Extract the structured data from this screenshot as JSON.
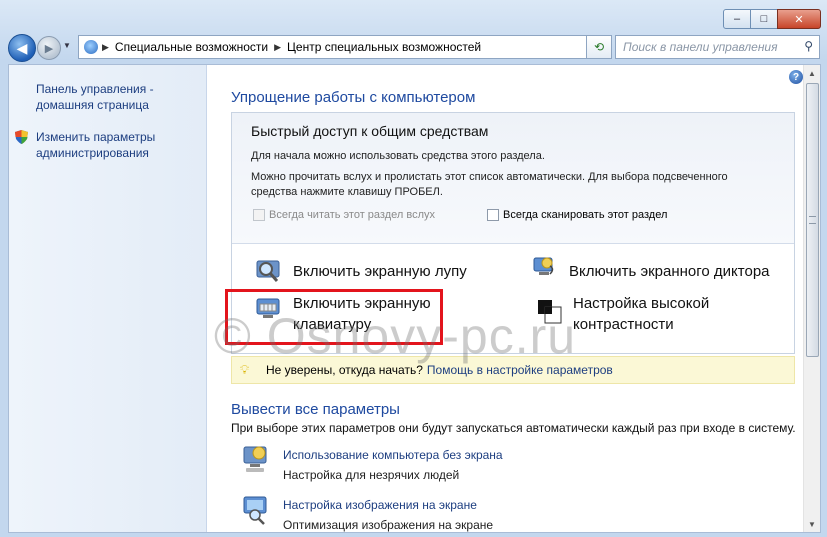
{
  "window": {
    "min_label": "–",
    "max_label": "□",
    "close_label": "✕"
  },
  "nav": {
    "back_glyph": "◀",
    "forward_glyph": "▶",
    "breadcrumb": [
      "Специальные возможности",
      "Центр специальных возможностей"
    ],
    "search_placeholder": "Поиск в панели управления"
  },
  "sidebar": {
    "items": [
      {
        "label": "Панель управления - домашняя страница"
      },
      {
        "label": "Изменить параметры администрирования",
        "icon": "shield-icon"
      }
    ]
  },
  "main": {
    "heading": "Упрощение работы с компьютером",
    "quick": {
      "title": "Быстрый доступ к общим средствам",
      "line1": "Для начала можно использовать средства этого раздела.",
      "line2": "Можно прочитать вслух и пролистать этот список автоматически. Для выбора подсвеченного средства нажмите клавишу ПРОБЕЛ.",
      "chk_read": "Всегда читать этот раздел вслух",
      "chk_scan": "Всегда сканировать этот раздел"
    },
    "tools": {
      "magnifier": "Включить экранную лупу",
      "narrator": "Включить экранного диктора",
      "keyboard_line1": "Включить экранную",
      "keyboard_line2": "клавиатуру",
      "contrast_line1": "Настройка высокой",
      "contrast_line2": "контрастности"
    },
    "tip": {
      "text": "Не уверены, откуда начать?",
      "link": "Помощь в настройке параметров"
    },
    "all_settings": {
      "heading": "Вывести все параметры",
      "desc": "При выборе этих параметров они будут запускаться автоматически каждый раз при входе в систему.",
      "items": [
        {
          "link": "Использование компьютера без экрана",
          "sub": "Настройка для незрячих людей"
        },
        {
          "link": "Настройка изображения на экране",
          "sub": "Оптимизация изображения на экране"
        }
      ]
    }
  },
  "watermark": "© Osnovy-pc.ru",
  "colors": {
    "link": "#1d3e80",
    "heading": "#1f4aa0",
    "highlight_box": "#e3141c",
    "tip_bg": "#fbf8d6"
  }
}
